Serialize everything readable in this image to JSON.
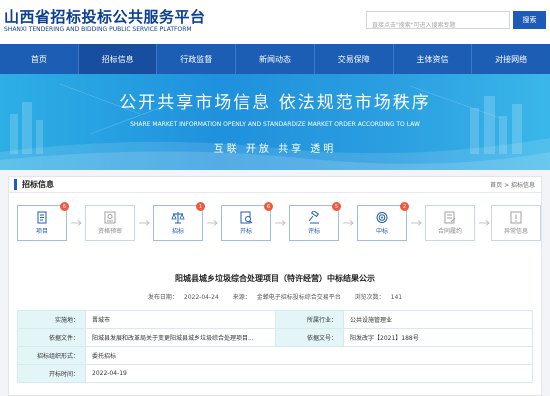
{
  "header": {
    "logo_cn": "山西省招标投标公共服务平台",
    "logo_en": "SHANXI TENDERING AND BIDDING PUBLIC SERVICE PLATFORM",
    "search_placeholder": "直接点击\"搜索\"可进入搜索专题",
    "search_button": "搜索"
  },
  "nav": {
    "items": [
      {
        "label": "首页"
      },
      {
        "label": "招标信息"
      },
      {
        "label": "行政监督"
      },
      {
        "label": "新闻动态"
      },
      {
        "label": "交易保障"
      },
      {
        "label": "主体资信"
      },
      {
        "label": "对接网络"
      }
    ],
    "active_index": 1
  },
  "banner": {
    "slogan": "公开共享市场信息   依法规范市场秩序",
    "sub": "SHARE MARKET INFORMATION OPENLY AND STANDARDIZE MARKET ORDER ACCORDING TO LAW",
    "keywords": "互联  开放  共享  透明"
  },
  "panel": {
    "title": "招标信息",
    "breadcrumb": "首页 > 招标信息"
  },
  "steps": [
    {
      "label": "项目",
      "badge": "6",
      "active": true,
      "icon": "document-icon"
    },
    {
      "label": "资格预审",
      "badge": "",
      "active": false,
      "icon": "qualification-icon"
    },
    {
      "label": "招标",
      "badge": "1",
      "active": true,
      "icon": "scale-icon"
    },
    {
      "label": "开标",
      "badge": "6",
      "active": true,
      "icon": "bid-opening-icon"
    },
    {
      "label": "评标",
      "badge": "5",
      "active": true,
      "icon": "gavel-icon"
    },
    {
      "label": "中标",
      "badge": "2",
      "active": true,
      "icon": "target-icon"
    },
    {
      "label": "合同履约",
      "badge": "",
      "active": false,
      "icon": "contract-icon"
    },
    {
      "label": "异常信息",
      "badge": "",
      "active": false,
      "icon": "warning-icon"
    }
  ],
  "notice": {
    "title": "阳城县城乡垃圾综合处理项目（特许经营）中标结果公示",
    "publish_label": "发布日期：",
    "publish_date": "2022-04-24",
    "source_label": "来源：",
    "source": "金蝉电子招标投标综合交易平台",
    "views_label": "浏览次数：",
    "views": "141"
  },
  "table": {
    "rows": [
      {
        "k1": "实施地：",
        "v1": "晋城市",
        "k2": "所属行业：",
        "v2": "公共设施管理业"
      },
      {
        "k1": "依据文件：",
        "v1": "阳城县发展和改革局关于变更阳城县城乡垃圾综合处理项目...",
        "k2": "依据文号：",
        "v2": "阳发改字【2021】188号"
      },
      {
        "k1": "招标组织形式：",
        "v1": "委托招标",
        "k2": "",
        "v2": ""
      },
      {
        "k1": "开标时间：",
        "v1": "2022-04-19",
        "k2": "",
        "v2": ""
      }
    ]
  },
  "colors": {
    "brand": "#1d5eb5",
    "badge": "#f05a3a",
    "table_key_bg": "#e4f5f7"
  }
}
